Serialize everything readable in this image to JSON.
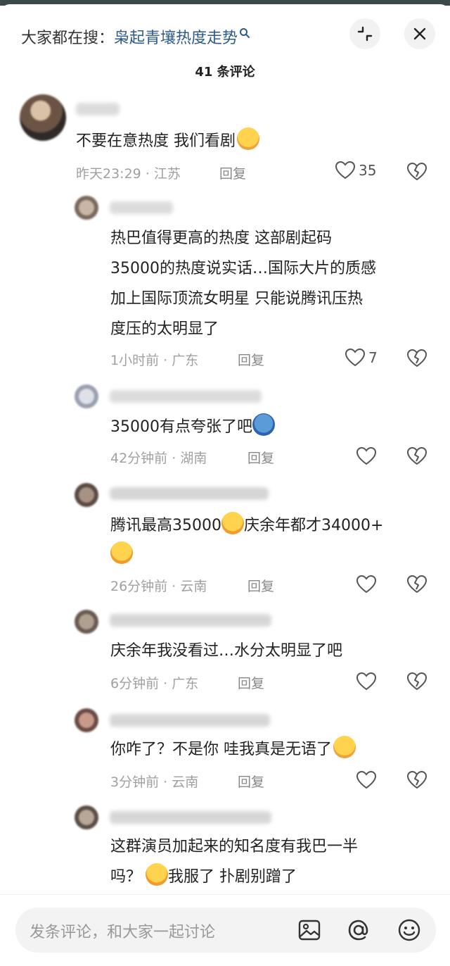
{
  "header": {
    "search_prefix": "大家都在搜：",
    "search_term": "枭起青壤热度走势",
    "comment_count": "41 条评论"
  },
  "comments": [
    {
      "text": "不要在意热度 我们看剧",
      "time": "昨天23:29",
      "location": "江苏",
      "reply": "回复",
      "likes": "35"
    },
    {
      "lines": [
        "热巴值得更高的热度 这部剧起码",
        "35000的热度说实话…国际大片的质感",
        "加上国际顶流女明星 只能说腾讯压热",
        "度压的太明显了"
      ],
      "time": "1小时前",
      "location": "广东",
      "reply": "回复",
      "likes": "7"
    },
    {
      "text": "35000有点夸张了吧",
      "time": "42分钟前",
      "location": "湖南",
      "reply": "回复",
      "likes": ""
    },
    {
      "line1": "腾讯最高35000",
      "line1b": "庆余年都才34000+",
      "time": "26分钟前",
      "location": "云南",
      "reply": "回复",
      "likes": ""
    },
    {
      "text": "庆余年我没看过…水分太明显了吧",
      "time": "6分钟前",
      "location": "广东",
      "reply": "回复",
      "likes": ""
    },
    {
      "text": "你咋了？不是你 哇我真是无语了",
      "time": "3分钟前",
      "location": "云南",
      "reply": "回复",
      "likes": ""
    },
    {
      "line1": "这群演员加起来的知名度有我巴一半",
      "line2a": "吗？",
      "line2b": "我服了 扑剧别蹭了"
    }
  ],
  "input": {
    "placeholder": "发条评论，和大家一起讨论"
  },
  "colors": {
    "accent": "#2c5a8a",
    "meta": "#a0a0a0"
  }
}
